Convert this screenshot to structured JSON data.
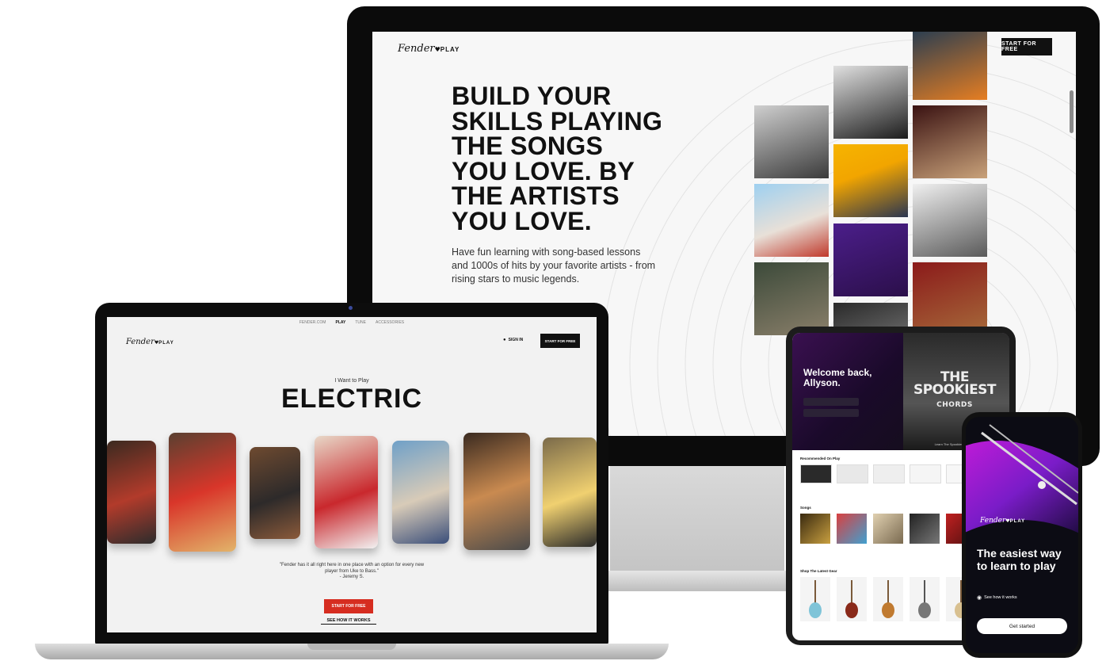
{
  "colors": {
    "brand_red": "#d62d20",
    "dark": "#111111",
    "purple": "#9b2bd6"
  },
  "desktop": {
    "logo_script": "Fender",
    "logo_word": "PLAY",
    "cta": "START FOR FREE",
    "headline": [
      "BUILD YOUR",
      "SKILLS PLAYING",
      "THE SONGS",
      "YOU LOVE. BY",
      "THE ARTISTS",
      "YOU LOVE."
    ],
    "subtext": "Have fun learning with song-based lessons and 1000s of hits by your favorite artists - from rising stars to music legends."
  },
  "laptop": {
    "topnav": [
      "FENDER.COM",
      "PLAY",
      "TUNE",
      "ACCESSORIES"
    ],
    "logo_script": "Fender",
    "logo_word": "PLAY",
    "sign_in": "SIGN IN",
    "cta": "START FOR FREE",
    "i_want": "I Want to Play",
    "instrument": "ELECTRIC",
    "quote": "\"Fender has it all right here in one place with an option for every new player from Uke to Bass.\"",
    "quote_author": "- Jeremy S.",
    "start_button": "START FOR FREE",
    "how_link": "SEE HOW IT WORKS"
  },
  "tablet": {
    "welcome": "Welcome back, Allyson.",
    "feature_title": "THE SPOOKIEST",
    "feature_sub": "CHORDS",
    "feature_caption": "Learn The Spookiest Chords",
    "sections": {
      "recommended": "Recommended On Play",
      "songs": "Songs",
      "gear": "Shop The Latest Gear"
    }
  },
  "phone": {
    "logo_script": "Fender",
    "logo_word": "PLAY",
    "headline": "The easiest way to learn to play",
    "how": "See how it works",
    "button": "Get started"
  }
}
